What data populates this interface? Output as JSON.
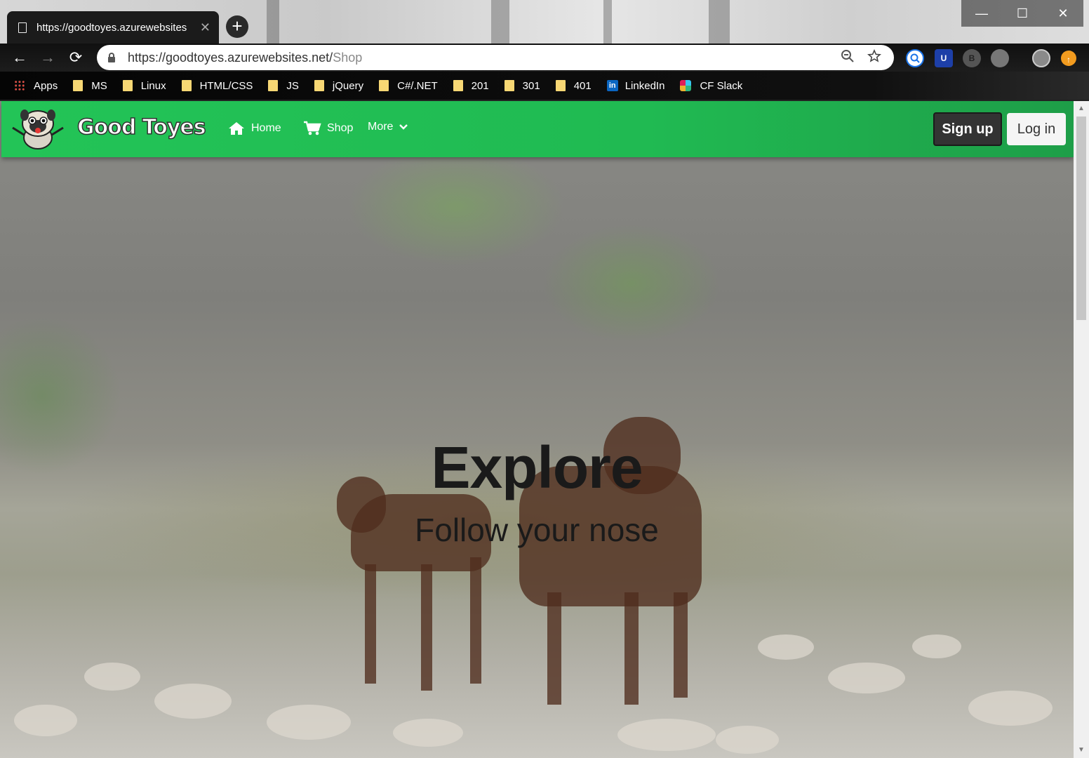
{
  "browser": {
    "tab_title": "https://goodtoyes.azurewebsites",
    "tab_close": "✕",
    "new_tab": "+",
    "window_controls": {
      "minimize": "—",
      "maximize": "☐",
      "close": "✕"
    },
    "url_host": "https://goodtoyes.azurewebsites.net/",
    "url_path": "Shop",
    "back": "←",
    "forward": "→",
    "reload": "⟳"
  },
  "bookmarks": [
    {
      "label": "Apps",
      "icon": "apps-grid-icon"
    },
    {
      "label": "MS",
      "icon": "folder-icon"
    },
    {
      "label": "Linux",
      "icon": "folder-icon"
    },
    {
      "label": "HTML/CSS",
      "icon": "folder-icon"
    },
    {
      "label": "JS",
      "icon": "folder-icon"
    },
    {
      "label": "jQuery",
      "icon": "folder-icon"
    },
    {
      "label": "C#/.NET",
      "icon": "folder-icon"
    },
    {
      "label": "201",
      "icon": "folder-icon"
    },
    {
      "label": "301",
      "icon": "folder-icon"
    },
    {
      "label": "401",
      "icon": "folder-icon"
    },
    {
      "label": "LinkedIn",
      "icon": "linkedin-icon"
    },
    {
      "label": "CF Slack",
      "icon": "slack-icon"
    }
  ],
  "site": {
    "brand": "Good Toyes",
    "nav": {
      "home": "Home",
      "shop": "Shop",
      "more": "More"
    },
    "signup": "Sign up",
    "login": "Log in",
    "accent": "#22c055"
  },
  "hero": {
    "title": "Explore",
    "subtitle": "Follow your nose"
  }
}
